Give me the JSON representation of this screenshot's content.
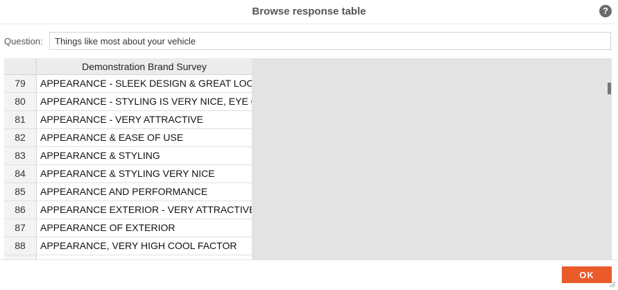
{
  "dialog": {
    "title": "Browse response table",
    "help_icon": "?"
  },
  "question": {
    "label": "Question:",
    "value": "Things like most about your vehicle"
  },
  "table": {
    "column_header": "Demonstration Brand Survey",
    "rows": [
      {
        "num": "79",
        "value": "APPEARANCE - SLEEK DESIGN & GREAT LOOKS"
      },
      {
        "num": "80",
        "value": "APPEARANCE - STYLING IS VERY NICE, EYE CATCHING"
      },
      {
        "num": "81",
        "value": "APPEARANCE - VERY ATTRACTIVE"
      },
      {
        "num": "82",
        "value": "APPEARANCE & EASE OF USE"
      },
      {
        "num": "83",
        "value": "APPEARANCE & STYLING"
      },
      {
        "num": "84",
        "value": "APPEARANCE & STYLING VERY NICE"
      },
      {
        "num": "85",
        "value": "APPEARANCE AND PERFORMANCE"
      },
      {
        "num": "86",
        "value": "APPEARANCE EXTERIOR - VERY ATTRACTIVE OVERALL"
      },
      {
        "num": "87",
        "value": "APPEARANCE OF EXTERIOR"
      },
      {
        "num": "88",
        "value": "APPEARANCE, VERY HIGH COOL FACTOR"
      }
    ]
  },
  "footer": {
    "ok_label": "OK"
  },
  "colors": {
    "accent": "#ea5a2a",
    "grid_background": "#e3e3e3",
    "header_background": "#ececec"
  }
}
